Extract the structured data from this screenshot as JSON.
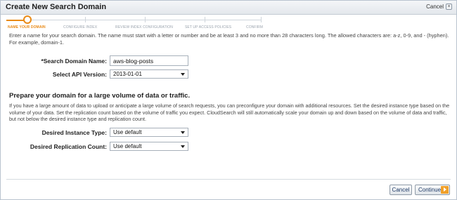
{
  "dialog": {
    "title": "Create New Search Domain",
    "close_label": "Cancel",
    "close_icon": "close-icon"
  },
  "steps": [
    {
      "label": "NAME YOUR DOMAIN",
      "active": true
    },
    {
      "label": "CONFIGURE INDEX",
      "active": false
    },
    {
      "label": "REVIEW INDEX CONFIGURATION",
      "active": false
    },
    {
      "label": "SET UP ACCESS POLICIES",
      "active": false
    },
    {
      "label": "CONFIRM",
      "active": false
    }
  ],
  "intro": "Enter a name for your search domain. The name must start with a letter or number and be at least 3 and no more than 28 characters long. The allowed characters are: a-z, 0-9, and - (hyphen). For example, domain-1.",
  "form": {
    "domain_name_label": "*Search Domain Name:",
    "domain_name_value": "aws-blog-posts",
    "api_version_label": "Select API Version:",
    "api_version_value": "2013-01-01"
  },
  "volume": {
    "heading": "Prepare your domain for a large volume of data or traffic.",
    "description": "If you have a large amount of data to upload or anticipate a large volume of search requests, you can preconfigure your domain with additional resources. Set the desired instance type based on the volume of your data. Set the replication count based on the volume of traffic you expect. CloudSearch will still automatically scale your domain up and down based on the volume of data and traffic, but not below the desired instance type and replication count.",
    "instance_type_label": "Desired Instance Type:",
    "instance_type_value": "Use default",
    "replication_label": "Desired Replication Count:",
    "replication_value": "Use default"
  },
  "footer": {
    "cancel_label": "Cancel",
    "continue_label": "Continue",
    "continue_icon": "arrow-right-icon"
  },
  "colors": {
    "accent": "#e98a17",
    "border": "#b9c3cf"
  }
}
